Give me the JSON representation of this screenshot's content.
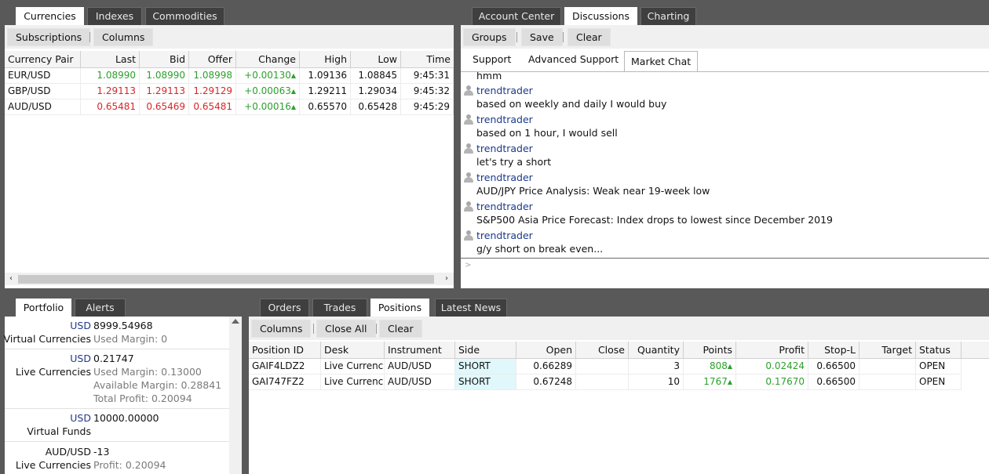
{
  "currencies_panel": {
    "tabs": [
      "Currencies",
      "Indexes",
      "Commodities"
    ],
    "toolbar": {
      "subscriptions": "Subscriptions",
      "columns": "Columns"
    },
    "columns": [
      "Currency Pair",
      "Last",
      "Bid",
      "Offer",
      "Change",
      "High",
      "Low",
      "Time"
    ],
    "rows": [
      {
        "pair": "EUR/USD",
        "last": "1.08990",
        "bid": "1.08990",
        "offer": "1.08998",
        "change": "+0.00130",
        "high": "1.09136",
        "low": "1.08845",
        "time": "9:45:31"
      },
      {
        "pair": "GBP/USD",
        "last": "1.29113",
        "bid": "1.29113",
        "offer": "1.29129",
        "change": "+0.00063",
        "high": "1.29211",
        "low": "1.29034",
        "time": "9:45:32"
      },
      {
        "pair": "AUD/USD",
        "last": "0.65481",
        "bid": "0.65469",
        "offer": "0.65481",
        "change": "+0.00016",
        "high": "0.65570",
        "low": "0.65428",
        "time": "9:45:29"
      }
    ],
    "row_colors": [
      "green",
      "red",
      "red"
    ],
    "scroll_left": "‹",
    "scroll_right": "›"
  },
  "discussions_panel": {
    "tabs": [
      "Account Center",
      "Discussions",
      "Charting"
    ],
    "toolbar": {
      "groups": "Groups",
      "save": "Save",
      "clear": "Clear"
    },
    "subtabs": [
      "Support",
      "Advanced Support",
      "Market Chat"
    ],
    "messages": [
      {
        "text": "hmm"
      },
      {
        "user": "trendtrader",
        "text": "based on weekly and daily I would buy"
      },
      {
        "user": "trendtrader",
        "text": "based on 1 hour, I would sell"
      },
      {
        "user": "trendtrader",
        "text": "let's try a short"
      },
      {
        "user": "trendtrader",
        "text": "AUD/JPY Price Analysis: Weak near 19-week low"
      },
      {
        "user": "trendtrader",
        "text": "S&P500 Asia Price Forecast: Index drops to lowest since December 2019"
      },
      {
        "user": "trendtrader",
        "text": "g/y short on break even..."
      }
    ],
    "input_placeholder": ">"
  },
  "portfolio_panel": {
    "tabs": [
      "Portfolio",
      "Alerts"
    ],
    "items": [
      {
        "code": "USD",
        "name": "Virtual Currencies",
        "value": "8999.54968",
        "lines": [
          {
            "label": "Used Margin:",
            "value": "0"
          }
        ]
      },
      {
        "code": "USD",
        "name": "Live Currencies",
        "value": "0.21747",
        "lines": [
          {
            "label": "Used Margin:",
            "value": "0.13000"
          },
          {
            "label": "Available Margin:",
            "value": "0.28841"
          },
          {
            "label": "Total Profit:",
            "value": "0.20094"
          }
        ]
      },
      {
        "code": "USD",
        "name": "Virtual Funds",
        "value": "10000.00000",
        "lines": []
      },
      {
        "code": "AUD/USD",
        "name": "Live Currencies",
        "value": "-13",
        "lines": [
          {
            "label": "Profit:",
            "value": "0.20094"
          }
        ]
      }
    ]
  },
  "positions_panel": {
    "tabs": [
      "Orders",
      "Trades",
      "Positions",
      "Latest News"
    ],
    "toolbar": {
      "columns": "Columns",
      "close_all": "Close All",
      "clear": "Clear"
    },
    "columns": [
      "Position ID",
      "Desk",
      "Instrument",
      "Side",
      "Open",
      "Close",
      "Quantity",
      "Points",
      "Profit",
      "Stop-L",
      "Target",
      "Status"
    ],
    "rows": [
      {
        "id": "GAIF4LDZ2",
        "desk": "Live Currencies",
        "instrument": "AUD/USD",
        "side": "SHORT",
        "open": "0.66289",
        "close": "",
        "quantity": "3",
        "points": "808",
        "profit": "0.02424",
        "stop": "0.66500",
        "target": "",
        "status": "OPEN"
      },
      {
        "id": "GAI747FZ2",
        "desk": "Live Currencies",
        "instrument": "AUD/USD",
        "side": "SHORT",
        "open": "0.67248",
        "close": "",
        "quantity": "10",
        "points": "1767",
        "profit": "0.17670",
        "stop": "0.66500",
        "target": "",
        "status": "OPEN"
      }
    ]
  },
  "colors": {
    "up": "#2ca02c",
    "down": "#d62728",
    "user": "#1a3a8a",
    "background": "#595959"
  },
  "icons": {
    "up_arrow": "▲",
    "avatar": "user-avatar-icon"
  }
}
